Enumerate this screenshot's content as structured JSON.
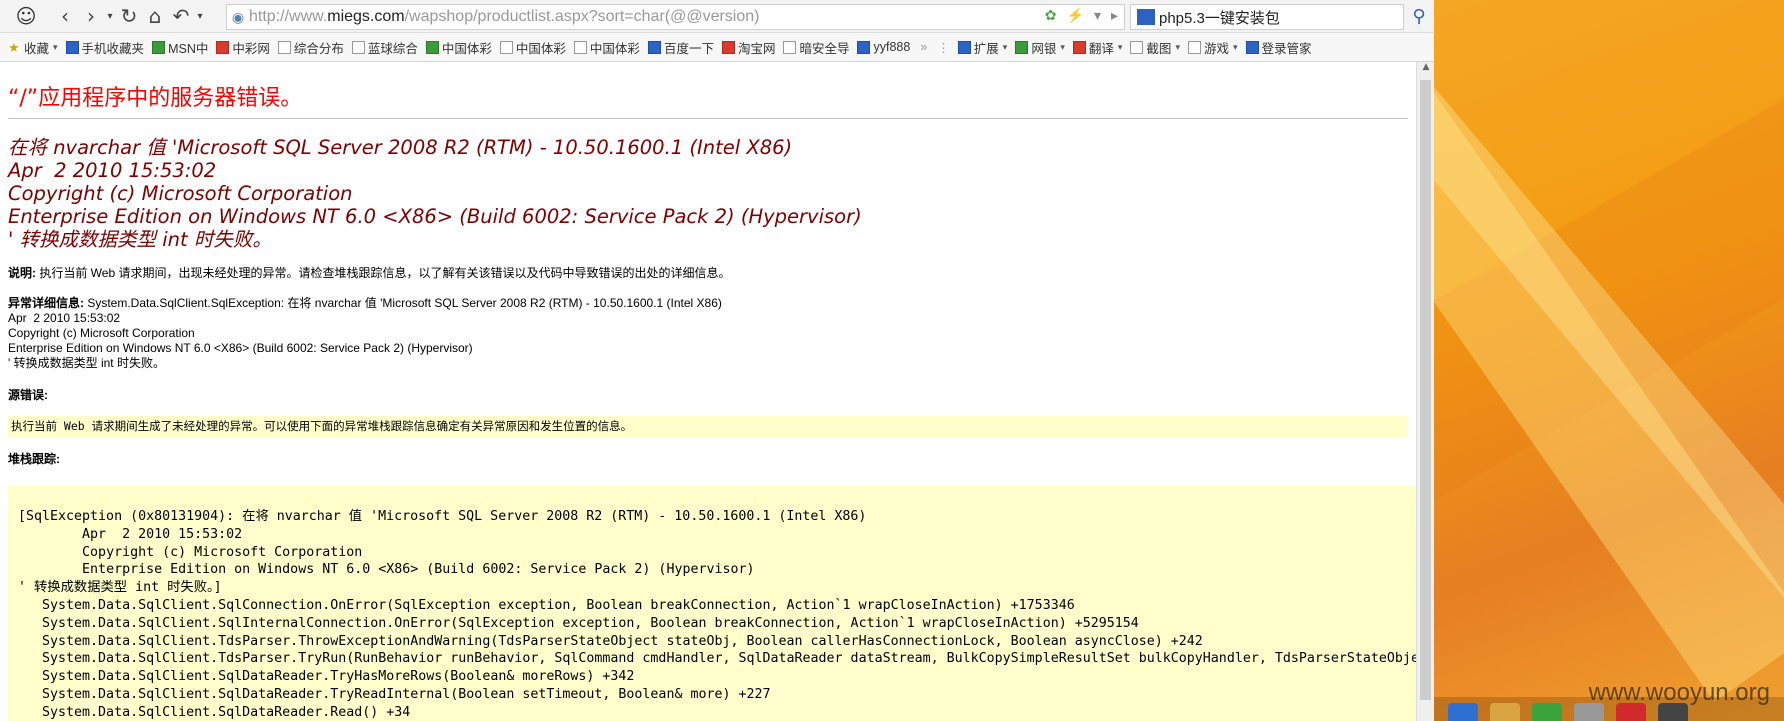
{
  "browser": {
    "url_prefix": "http://www.",
    "url_domain": "miegs.com",
    "url_suffix": "/wapshop/productlist.aspx?sort=char(@@version)",
    "search_text": "php5.3一键安装包"
  },
  "bookmarks": [
    {
      "label": "收藏",
      "icon": "star-icon"
    },
    {
      "label": "手机收藏夹",
      "icon": "phone-icon"
    },
    {
      "label": "MSN中",
      "icon": "msn-icon"
    },
    {
      "label": "中彩网",
      "icon": "lottery-icon"
    },
    {
      "label": "综合分布",
      "icon": "page-icon"
    },
    {
      "label": "蓝球综合",
      "icon": "page-icon"
    },
    {
      "label": "中国体彩",
      "icon": "sports-icon"
    },
    {
      "label": "中国体彩",
      "icon": "page-icon"
    },
    {
      "label": "中国体彩",
      "icon": "page-icon"
    },
    {
      "label": "百度一下",
      "icon": "baidu-icon"
    },
    {
      "label": "淘宝网",
      "icon": "taobao-icon"
    },
    {
      "label": "暗安全导",
      "icon": "page-icon"
    },
    {
      "label": "yyf888",
      "icon": "ct-icon"
    }
  ],
  "tools": [
    {
      "label": "扩展",
      "icon": "extension-icon"
    },
    {
      "label": "网银",
      "icon": "bank-icon"
    },
    {
      "label": "翻译",
      "icon": "translate-icon"
    },
    {
      "label": "截图",
      "icon": "screenshot-icon"
    },
    {
      "label": "游戏",
      "icon": "game-icon"
    },
    {
      "label": "登录管家",
      "icon": "login-icon"
    }
  ],
  "page": {
    "title": "“/”应用程序中的服务器错误。",
    "error_message": "在将 nvarchar 值 'Microsoft SQL Server 2008 R2 (RTM) - 10.50.1600.1 (Intel X86)\nApr  2 2010 15:53:02\nCopyright (c) Microsoft Corporation\nEnterprise Edition on Windows NT 6.0 <X86> (Build 6002: Service Pack 2) (Hypervisor)\n' 转换成数据类型 int 时失败。",
    "desc_label": "说明: ",
    "desc_text": "执行当前 Web 请求期间，出现未经处理的异常。请检查堆栈跟踪信息，以了解有关该错误以及代码中导致错误的出处的详细信息。",
    "exception_label": "异常详细信息: ",
    "exception_text": "System.Data.SqlClient.SqlException: 在将 nvarchar 值 'Microsoft SQL Server 2008 R2 (RTM) - 10.50.1600.1 (Intel X86)\nApr  2 2010 15:53:02\nCopyright (c) Microsoft Corporation\nEnterprise Edition on Windows NT 6.0 <X86> (Build 6002: Service Pack 2) (Hypervisor)\n' 转换成数据类型 int 时失败。",
    "source_label": "源错误:",
    "source_text": "执行当前 Web 请求期间生成了未经处理的异常。可以使用下面的异常堆栈跟踪信息确定有关异常原因和发生位置的信息。",
    "stack_label": "堆栈跟踪:",
    "stack_trace": "[SqlException (0x80131904): 在将 nvarchar 值 'Microsoft SQL Server 2008 R2 (RTM) - 10.50.1600.1 (Intel X86)\n\tApr  2 2010 15:53:02\n\tCopyright (c) Microsoft Corporation\n\tEnterprise Edition on Windows NT 6.0 <X86> (Build 6002: Service Pack 2) (Hypervisor)\n' 转换成数据类型 int 时失败。]\n   System.Data.SqlClient.SqlConnection.OnError(SqlException exception, Boolean breakConnection, Action`1 wrapCloseInAction) +1753346\n   System.Data.SqlClient.SqlInternalConnection.OnError(SqlException exception, Boolean breakConnection, Action`1 wrapCloseInAction) +5295154\n   System.Data.SqlClient.TdsParser.ThrowExceptionAndWarning(TdsParserStateObject stateObj, Boolean callerHasConnectionLock, Boolean asyncClose) +242\n   System.Data.SqlClient.TdsParser.TryRun(RunBehavior runBehavior, SqlCommand cmdHandler, SqlDataReader dataStream, BulkCopySimpleResultSet bulkCopyHandler, TdsParserStateObject stateObj\n   System.Data.SqlClient.SqlDataReader.TryHasMoreRows(Boolean& moreRows) +342\n   System.Data.SqlClient.SqlDataReader.TryReadInternal(Boolean setTimeout, Boolean& more) +227\n   System.Data.SqlClient.SqlDataReader.Read() +34"
  },
  "desktop": {
    "watermark": "www.wooyun.org"
  }
}
